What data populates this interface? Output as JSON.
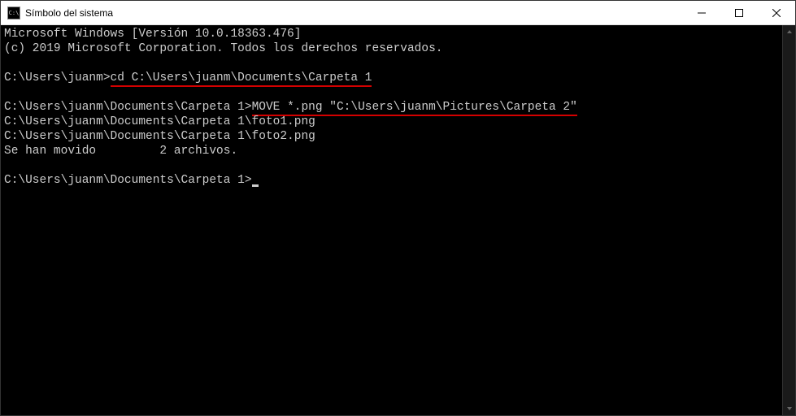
{
  "window": {
    "title": "Símbolo del sistema",
    "icon_label": "C:\\"
  },
  "terminal": {
    "header_line1": "Microsoft Windows [Versión 10.0.18363.476]",
    "header_line2": "(c) 2019 Microsoft Corporation. Todos los derechos reservados.",
    "prompt1_path": "C:\\Users\\juanm>",
    "prompt1_cmd": "cd C:\\Users\\juanm\\Documents\\Carpeta 1",
    "prompt2_path": "C:\\Users\\juanm\\Documents\\Carpeta 1>",
    "prompt2_cmd": "MOVE *.png \"C:\\Users\\juanm\\Pictures\\Carpeta 2\"",
    "output_line1": "C:\\Users\\juanm\\Documents\\Carpeta 1\\foto1.png",
    "output_line2": "C:\\Users\\juanm\\Documents\\Carpeta 1\\foto2.png",
    "output_line3": "Se han movido         2 archivos.",
    "prompt3_path": "C:\\Users\\juanm\\Documents\\Carpeta 1>"
  }
}
